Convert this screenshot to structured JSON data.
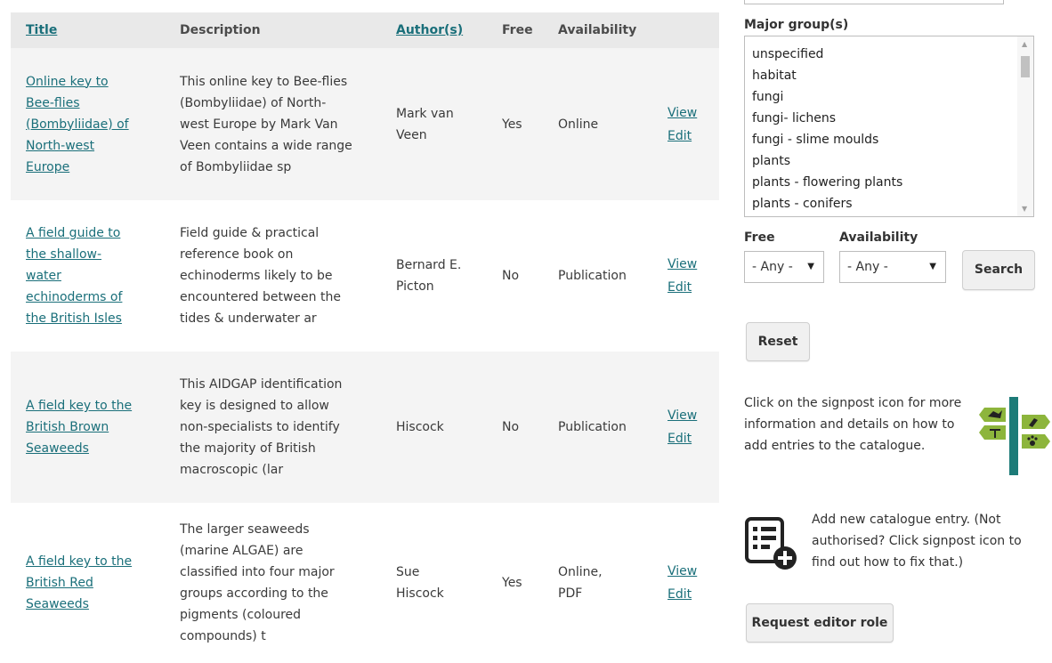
{
  "table": {
    "headers": {
      "title": "Title",
      "description": "Description",
      "authors": "Author(s)",
      "free": "Free",
      "availability": "Availability"
    },
    "rows": [
      {
        "title_lines": [
          "Online key to",
          "Bee-flies",
          "(Bombyliidae) of",
          "North-west",
          "Europe"
        ],
        "description_lines": [
          "This online key to Bee-flies",
          "(Bombyliidae) of North-",
          "west Europe by Mark Van",
          "Veen contains a wide range",
          "of Bombyliidae sp"
        ],
        "author_lines": [
          "Mark van",
          "Veen"
        ],
        "free": "Yes",
        "availability_lines": [
          "Online"
        ],
        "view": "View",
        "edit": "Edit"
      },
      {
        "title_lines": [
          "A field guide to",
          "the shallow-",
          "water",
          "echinoderms of",
          "the British Isles"
        ],
        "description_lines": [
          "Field guide & practical",
          "reference book on",
          "echinoderms likely to be",
          "encountered between the",
          "tides & underwater ar"
        ],
        "author_lines": [
          "Bernard E.",
          "Picton"
        ],
        "free": "No",
        "availability_lines": [
          "Publication"
        ],
        "view": "View",
        "edit": "Edit"
      },
      {
        "title_lines": [
          "A field key to the",
          "British Brown",
          "Seaweeds"
        ],
        "description_lines": [
          "This AIDGAP identification",
          "key is designed to allow",
          "non-specialists to identify",
          "the majority of British",
          "macroscopic (lar"
        ],
        "author_lines": [
          "Hiscock"
        ],
        "free": "No",
        "availability_lines": [
          "Publication"
        ],
        "view": "View",
        "edit": "Edit"
      },
      {
        "title_lines": [
          "A field key to the",
          "British Red",
          "Seaweeds"
        ],
        "description_lines": [
          "The larger seaweeds",
          "(marine ALGAE) are",
          "classified into four major",
          "groups according to the",
          "pigments (coloured",
          "compounds) t"
        ],
        "author_lines": [
          "Sue",
          "Hiscock"
        ],
        "free": "Yes",
        "availability_lines": [
          "Online,",
          "PDF"
        ],
        "view": "View",
        "edit": "Edit"
      }
    ]
  },
  "filters": {
    "major_group_label": "Major group(s)",
    "major_groups": [
      "unspecified",
      "habitat",
      "fungi",
      "fungi- lichens",
      "fungi - slime moulds",
      "plants",
      "plants - flowering plants",
      "plants - conifers"
    ],
    "free_label": "Free",
    "free_value": "- Any -",
    "availability_label": "Availability",
    "availability_value": "- Any -",
    "search_button": "Search",
    "reset_button": "Reset"
  },
  "info": {
    "signpost_text": "Click on the signpost icon for more information and details on how to add entries to the catalogue.",
    "add_entry_text": "Add new catalogue entry. (Not authorised? Click signpost icon to find out how to fix that.)",
    "request_editor_button": "Request editor role"
  },
  "colors": {
    "link": "#1a6f7a",
    "signpost_pole": "#1d7b78",
    "signpost_sign": "#8db53c"
  },
  "icons": {
    "signpost": "signpost-icon",
    "add_entry": "add-catalogue-entry-icon",
    "dropdown": "caret-down-icon"
  }
}
